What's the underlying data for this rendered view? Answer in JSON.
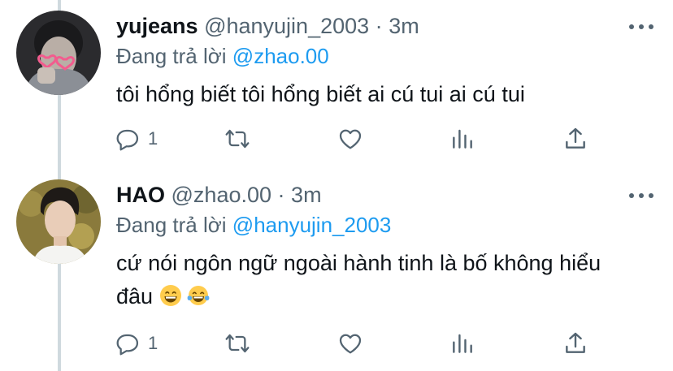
{
  "tweets": [
    {
      "name": "yujeans",
      "handle": "@hanyujin_2003",
      "separator": "·",
      "time": "3m",
      "reply_prefix": "Đang trả lời",
      "reply_to": "@zhao.00",
      "text": "tôi hổng biết tôi hổng biết ai cú tui ai cú tui",
      "reply_count": "1"
    },
    {
      "name": "HAO",
      "handle": "@zhao.00",
      "separator": "·",
      "time": "3m",
      "reply_prefix": "Đang trả lời",
      "reply_to": "@hanyujin_2003",
      "text_line1": "cứ nói ngôn ngữ ngoài hành tinh là bố không hiểu",
      "text_line2": "đâu",
      "reply_count": "1"
    }
  ],
  "colors": {
    "text": "#0f1419",
    "secondary": "#536471",
    "link": "#1d9bf0",
    "thread_line": "#cfd9de"
  },
  "icons": [
    "reply-icon",
    "retweet-icon",
    "like-icon",
    "views-icon",
    "share-icon",
    "more-icon",
    "grinning-emoji",
    "tears-of-joy-emoji"
  ]
}
